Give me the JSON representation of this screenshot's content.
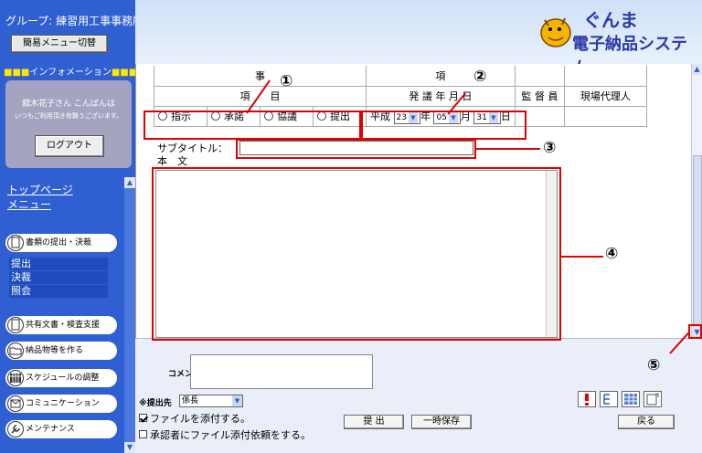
{
  "sidebar": {
    "group_label": "グループ: 練習用工事事務所(工事)",
    "simple_menu_btn": "簡易メニュー切替",
    "info_header": "インフォメーション",
    "user_greeting": "舘木花子さん こんばんは",
    "user_thanks": "いつもご利用頂き有難うございます。",
    "logout_btn": "ログアウト",
    "top_menu_line1": "トップページ",
    "top_menu_line2": "メニュー",
    "nav": [
      {
        "label": "書類の提出・決裁",
        "icon": "document-icon"
      },
      {
        "label": "共有文書・検査支援",
        "icon": "shared-document-icon"
      },
      {
        "label": "納品物等を作る",
        "icon": "folder-icon"
      },
      {
        "label": "スケジュールの調整",
        "icon": "calendar-icon"
      },
      {
        "label": "コミュニケーション",
        "icon": "mail-icon"
      },
      {
        "label": "メンテナンス",
        "icon": "wrench-icon"
      }
    ],
    "subnav": [
      "提出",
      "決裁",
      "照会"
    ]
  },
  "header": {
    "logo_line1": "ぐんま",
    "logo_line2": "電子納品システム"
  },
  "form": {
    "col_jiko_left": "事",
    "col_jiko_right": "項",
    "col_item": "項　　目",
    "col_date": "発 議 年 月 日",
    "col_supervisor": "監 督 員",
    "col_site_rep": "現場代理人",
    "radios": [
      "指示",
      "承諾",
      "協議",
      "提出"
    ],
    "era": "平成",
    "year": "23",
    "year_unit": "年",
    "month": "05",
    "month_unit": "月",
    "day": "31",
    "day_unit": "日",
    "subtitle_label": "サブタイトル：",
    "body_label": "本　文"
  },
  "footer": {
    "comment_label": "コメント",
    "dest_label": "※提出先",
    "dest_value": "係長",
    "attach_checkbox": "ファイルを添付する。",
    "request_checkbox": "承認者にファイル添付依頼をする。",
    "submit_btn": "提 出",
    "temp_save_btn": "一時保存",
    "back_btn": "戻る"
  },
  "callouts": [
    "①",
    "②",
    "③",
    "④",
    "⑤"
  ],
  "colors": {
    "sidebar": "#2f5fd0",
    "annotation": "#e00000"
  }
}
